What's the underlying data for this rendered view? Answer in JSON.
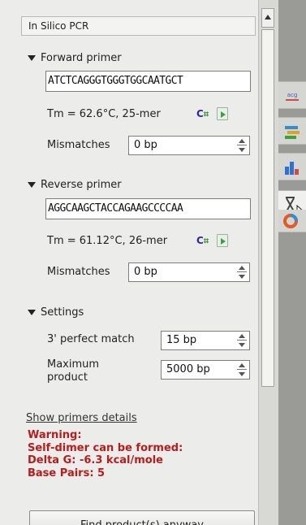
{
  "panel": {
    "title": "In Silico PCR",
    "forward": {
      "heading": "Forward primer",
      "sequence": "ATCTCAGGGTGGGTGGCAATGCT",
      "tm": "Tm = 62.6°C, 25-mer",
      "mismatches_label": "Mismatches",
      "mismatches_value": "0 bp"
    },
    "reverse": {
      "heading": "Reverse primer",
      "sequence": "AGGCAAGCTACCAGAAGCCCCAA",
      "tm": "Tm = 61.12°C, 26-mer",
      "mismatches_label": "Mismatches",
      "mismatches_value": "0 bp"
    },
    "settings": {
      "heading": "Settings",
      "perfect_match_label": "3' perfect match",
      "perfect_match_value": "15 bp",
      "max_product_label_1": "Maximum",
      "max_product_label_2": "product",
      "max_product_value": "5000 bp"
    },
    "show_details": "Show primers details",
    "warning": {
      "line1": "Warning:",
      "line2": "Self-dimer can be formed:",
      "line3": "Delta G: -6.3 kcal/mole",
      "line4": "Base Pairs: 5"
    },
    "find_button": "Find product(s) anyway"
  },
  "side_tabs": [
    {
      "icon": "sequence-view-icon"
    },
    {
      "icon": "annotations-icon"
    },
    {
      "icon": "statistics-icon"
    },
    {
      "icon": "pcr-icon"
    },
    {
      "icon": "circular-view-icon"
    }
  ],
  "colors": {
    "warning": "#b81d1d",
    "panel_bg": "#ececea",
    "strip_bg": "#9a9a97"
  }
}
